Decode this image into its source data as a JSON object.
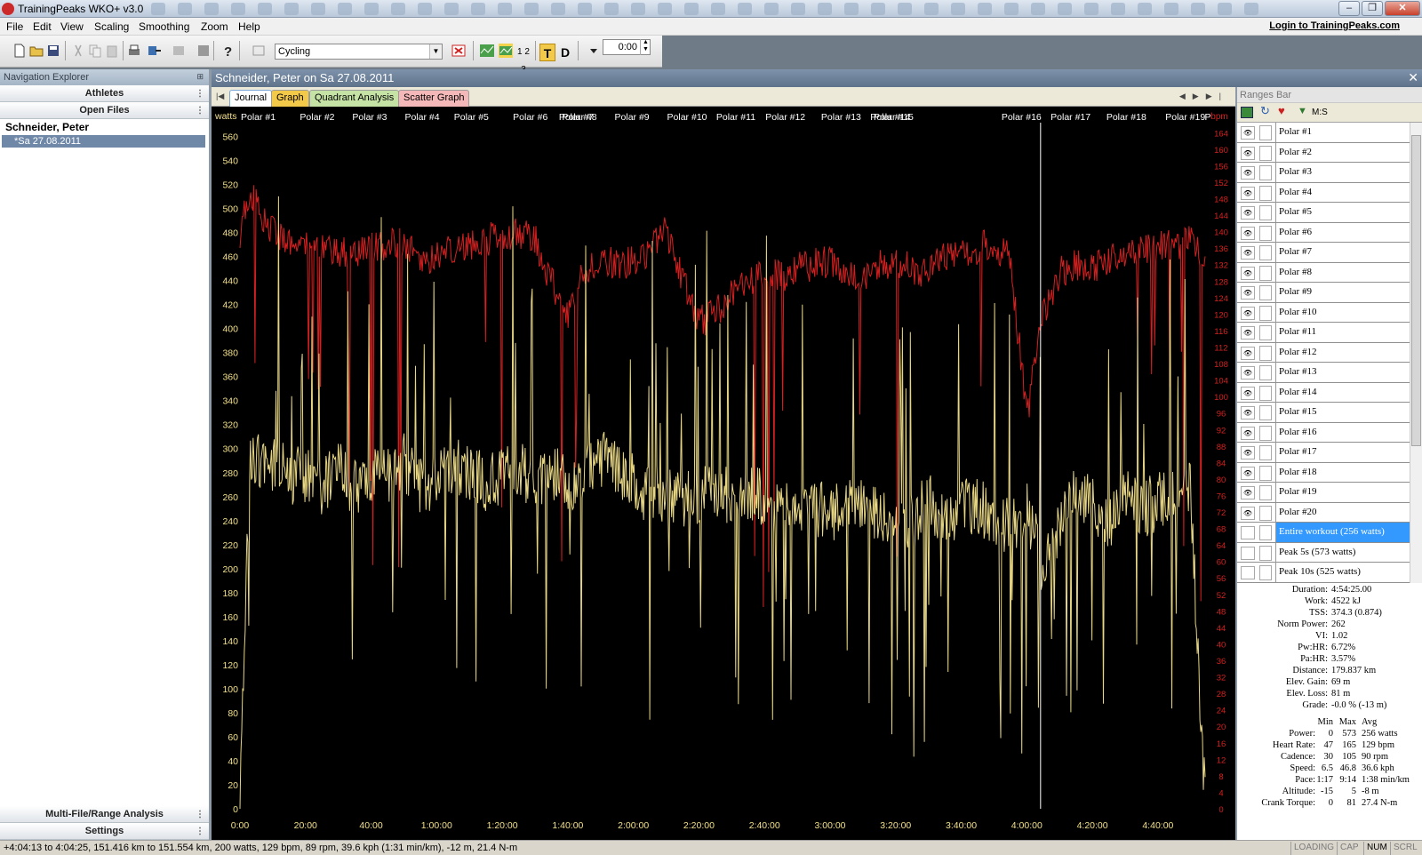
{
  "window": {
    "title": "TrainingPeaks WKO+ v3.0"
  },
  "menu": {
    "items": [
      "File",
      "Edit",
      "View",
      "Scaling",
      "Smoothing",
      "Zoom",
      "Help"
    ],
    "login": "Login to TrainingPeaks.com"
  },
  "toolbar": {
    "sport": "Cycling",
    "t_label": "T",
    "d_label": "D",
    "numbers_label": "1 2 3",
    "time": "0:00"
  },
  "nav": {
    "title": "Navigation Explorer",
    "athletes": "Athletes",
    "open_files": "Open Files",
    "athlete_name": "Schneider, Peter",
    "file": "*Sa 27.08.2011",
    "multi_file": "Multi-File/Range Analysis",
    "settings": "Settings"
  },
  "document": {
    "title": "Schneider, Peter on Sa 27.08.2011",
    "tabs": [
      "Journal",
      "Graph",
      "Quadrant Analysis",
      "Scatter Graph"
    ]
  },
  "chart_data": {
    "type": "line",
    "left_axis": {
      "label": "watts",
      "ticks": [
        0,
        20,
        40,
        60,
        80,
        100,
        120,
        140,
        160,
        180,
        200,
        220,
        240,
        260,
        280,
        300,
        320,
        340,
        360,
        380,
        400,
        420,
        440,
        460,
        480,
        500,
        520,
        540,
        560
      ],
      "range": [
        0,
        570
      ]
    },
    "right_axis": {
      "label": "bpm",
      "ticks": [
        0,
        4,
        8,
        12,
        16,
        20,
        24,
        28,
        32,
        36,
        40,
        44,
        48,
        52,
        56,
        60,
        64,
        68,
        72,
        76,
        80,
        84,
        88,
        92,
        96,
        100,
        104,
        108,
        112,
        116,
        120,
        124,
        128,
        132,
        136,
        140,
        144,
        148,
        152,
        156,
        160,
        164
      ],
      "range": [
        0,
        166
      ]
    },
    "x_axis": {
      "ticks": [
        "0:00",
        "20:00",
        "40:00",
        "1:00:00",
        "1:20:00",
        "1:40:00",
        "2:00:00",
        "2:20:00",
        "2:40:00",
        "3:00:00",
        "3:20:00",
        "3:40:00",
        "4:00:00",
        "4:20:00",
        "4:40:00"
      ],
      "tick_minutes": [
        0,
        20,
        40,
        60,
        80,
        100,
        120,
        140,
        160,
        180,
        200,
        220,
        240,
        260,
        280
      ],
      "max_minutes": 294.4
    },
    "range_markers": [
      {
        "label": "Polar #1",
        "minute": 0
      },
      {
        "label": "Polar #2",
        "minute": 18
      },
      {
        "label": "Polar #3",
        "minute": 34
      },
      {
        "label": "Polar #4",
        "minute": 50
      },
      {
        "label": "Polar #5",
        "minute": 65
      },
      {
        "label": "Polar #6",
        "minute": 83
      },
      {
        "label": "Polar #7",
        "minute": 97
      },
      {
        "label": "Polar #8",
        "minute": 98
      },
      {
        "label": "Polar #9",
        "minute": 114
      },
      {
        "label": "Polar #10",
        "minute": 130
      },
      {
        "label": "Polar #11",
        "minute": 145
      },
      {
        "label": "Polar #12",
        "minute": 160
      },
      {
        "label": "Polar #13",
        "minute": 177
      },
      {
        "label": "Polar #14",
        "minute": 192
      },
      {
        "label": "Polar #15",
        "minute": 193
      },
      {
        "label": "Polar #16",
        "minute": 232
      },
      {
        "label": "Polar #17",
        "minute": 247
      },
      {
        "label": "Polar #18",
        "minute": 264
      },
      {
        "label": "Polar #19",
        "minute": 282
      },
      {
        "label": "P",
        "minute": 294
      }
    ],
    "cursor_minute": 244.2,
    "series": [
      {
        "name": "Power",
        "unit": "watts",
        "axis": "left",
        "color": "#f2e08a",
        "minutes": [
          0,
          3,
          6,
          10,
          15,
          20,
          25,
          30,
          35,
          40,
          45,
          50,
          55,
          60,
          65,
          70,
          75,
          80,
          85,
          90,
          95,
          100,
          105,
          110,
          115,
          120,
          125,
          130,
          135,
          140,
          145,
          150,
          155,
          160,
          165,
          170,
          175,
          180,
          185,
          190,
          195,
          200,
          205,
          210,
          215,
          220,
          225,
          230,
          235,
          240,
          245,
          250,
          255,
          260,
          265,
          270,
          275,
          280,
          285,
          290,
          294
        ],
        "values": [
          20,
          300,
          285,
          290,
          275,
          280,
          270,
          285,
          265,
          280,
          275,
          290,
          270,
          275,
          285,
          280,
          270,
          275,
          285,
          265,
          280,
          270,
          280,
          290,
          285,
          270,
          260,
          265,
          255,
          260,
          270,
          255,
          265,
          260,
          250,
          255,
          250,
          245,
          260,
          255,
          245,
          250,
          240,
          255,
          245,
          250,
          255,
          240,
          235,
          250,
          200,
          230,
          265,
          255,
          240,
          260,
          250,
          255,
          270,
          265,
          20
        ]
      },
      {
        "name": "Heart Rate",
        "unit": "bpm",
        "axis": "right",
        "color": "#d42020",
        "minutes": [
          0,
          3,
          6,
          10,
          15,
          20,
          25,
          30,
          35,
          40,
          45,
          50,
          55,
          60,
          65,
          70,
          75,
          80,
          85,
          90,
          95,
          100,
          105,
          110,
          115,
          120,
          125,
          130,
          135,
          140,
          145,
          150,
          155,
          160,
          165,
          170,
          175,
          180,
          185,
          190,
          195,
          200,
          205,
          210,
          215,
          220,
          225,
          230,
          235,
          240,
          245,
          250,
          255,
          260,
          265,
          270,
          275,
          280,
          285,
          290,
          294
        ],
        "values": [
          140,
          150,
          145,
          140,
          138,
          137,
          136,
          135,
          134,
          136,
          137,
          138,
          133,
          134,
          136,
          137,
          138,
          139,
          140,
          138,
          128,
          120,
          130,
          134,
          132,
          133,
          135,
          140,
          128,
          118,
          120,
          125,
          128,
          130,
          129,
          131,
          132,
          133,
          130,
          128,
          132,
          133,
          131,
          130,
          134,
          135,
          136,
          137,
          133,
          95,
          120,
          130,
          132,
          131,
          133,
          134,
          135,
          136,
          137,
          138,
          132
        ]
      }
    ]
  },
  "ranges_bar": {
    "title": "Ranges Bar",
    "toolbar_label": "M:S",
    "items": [
      "Polar #1",
      "Polar #2",
      "Polar #3",
      "Polar #4",
      "Polar #5",
      "Polar #6",
      "Polar #7",
      "Polar #8",
      "Polar #9",
      "Polar #10",
      "Polar #11",
      "Polar #12",
      "Polar #13",
      "Polar #14",
      "Polar #15",
      "Polar #16",
      "Polar #17",
      "Polar #18",
      "Polar #19",
      "Polar #20",
      "Entire workout (256 watts)",
      "Peak 5s (573 watts)",
      "Peak 10s (525 watts)"
    ],
    "selected_index": 20
  },
  "stats": {
    "summary": [
      {
        "k": "Duration:",
        "v": "4:54:25.00"
      },
      {
        "k": "Work:",
        "v": "4522 kJ"
      },
      {
        "k": "TSS:",
        "v": "374.3 (0.874)"
      },
      {
        "k": "Norm Power:",
        "v": "262"
      },
      {
        "k": "VI:",
        "v": "1.02"
      },
      {
        "k": "Pw:HR:",
        "v": "6.72%"
      },
      {
        "k": "Pa:HR:",
        "v": "3.57%"
      },
      {
        "k": "Distance:",
        "v": "179.837 km"
      },
      {
        "k": "Elev. Gain:",
        "v": "69 m"
      },
      {
        "k": "Elev. Loss:",
        "v": "81 m"
      },
      {
        "k": "Grade:",
        "v": "-0.0 % (-13 m)"
      }
    ],
    "minmax_header": [
      "Min",
      "Max",
      "Avg"
    ],
    "minmax": [
      {
        "k": "Power:",
        "min": "0",
        "max": "573",
        "avg": "256 watts"
      },
      {
        "k": "Heart Rate:",
        "min": "47",
        "max": "165",
        "avg": "129 bpm"
      },
      {
        "k": "Cadence:",
        "min": "30",
        "max": "105",
        "avg": "90 rpm"
      },
      {
        "k": "Speed:",
        "min": "6.5",
        "max": "46.8",
        "avg": "36.6 kph"
      },
      {
        "k": "Pace:",
        "min": "1:17",
        "max": "9:14",
        "avg": "1:38 min/km"
      },
      {
        "k": "Altitude:",
        "min": "-15",
        "max": "5",
        "avg": "-8 m"
      },
      {
        "k": "Crank Torque:",
        "min": "0",
        "max": "81",
        "avg": "27.4 N-m"
      }
    ]
  },
  "status": {
    "text": "+4:04:13 to 4:04:25, 151.416 km to 151.554 km, 200 watts, 129 bpm, 89 rpm, 39.6 kph (1:31 min/km), -12 m, 21.4 N-m",
    "indicators": [
      {
        "label": "LOADING",
        "on": false
      },
      {
        "label": "CAP",
        "on": false
      },
      {
        "label": "NUM",
        "on": true
      },
      {
        "label": "SCRL",
        "on": false
      }
    ]
  }
}
